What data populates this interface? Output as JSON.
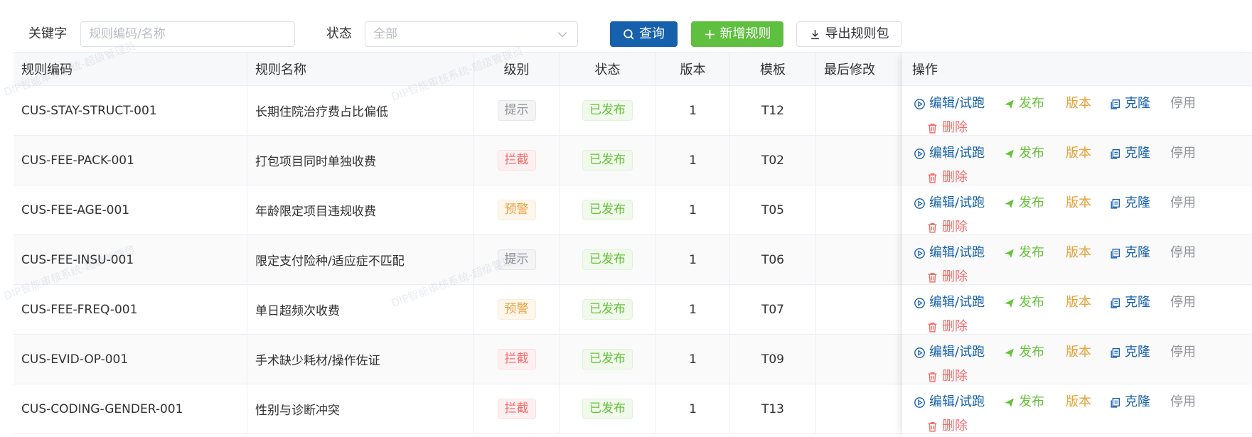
{
  "filters": {
    "keyword_label": "关键字",
    "keyword_placeholder": "规则编码/名称",
    "status_label": "状态",
    "status_value": "全部"
  },
  "actions": {
    "search_label": "查询",
    "add_label": "新增规则",
    "export_label": "导出规则包"
  },
  "table": {
    "columns": [
      "规则编码",
      "规则名称",
      "级别",
      "状态",
      "版本",
      "模板",
      "最后修改",
      "操作"
    ],
    "rows": [
      {
        "code": "CUS-STAY-STRUCT-001",
        "name": "长期住院治疗费占比偏低",
        "level": "提示",
        "level_type": "info",
        "status": "已发布",
        "version": "1",
        "template": "T12",
        "modified": ""
      },
      {
        "code": "CUS-FEE-PACK-001",
        "name": "打包项目同时单独收费",
        "level": "拦截",
        "level_type": "danger",
        "status": "已发布",
        "version": "1",
        "template": "T02",
        "modified": ""
      },
      {
        "code": "CUS-FEE-AGE-001",
        "name": "年龄限定项目违规收费",
        "level": "预警",
        "level_type": "warning",
        "status": "已发布",
        "version": "1",
        "template": "T05",
        "modified": ""
      },
      {
        "code": "CUS-FEE-INSU-001",
        "name": "限定支付险种/适应症不匹配",
        "level": "提示",
        "level_type": "info",
        "status": "已发布",
        "version": "1",
        "template": "T06",
        "modified": ""
      },
      {
        "code": "CUS-FEE-FREQ-001",
        "name": "单日超频次收费",
        "level": "预警",
        "level_type": "warning",
        "status": "已发布",
        "version": "1",
        "template": "T07",
        "modified": ""
      },
      {
        "code": "CUS-EVID-OP-001",
        "name": "手术缺少耗材/操作佐证",
        "level": "拦截",
        "level_type": "danger",
        "status": "已发布",
        "version": "1",
        "template": "T09",
        "modified": ""
      },
      {
        "code": "CUS-CODING-GENDER-001",
        "name": "性别与诊断冲突",
        "level": "拦截",
        "level_type": "danger",
        "status": "已发布",
        "version": "1",
        "template": "T13",
        "modified": ""
      }
    ],
    "row_actions": {
      "edit": "编辑/试跑",
      "publish": "发布",
      "version": "版本",
      "clone": "克隆",
      "disable": "停用",
      "delete": "删除"
    }
  },
  "watermark_text": "DIP智能审核系统-超级管理员",
  "colors": {
    "primary": "#1761ac",
    "success": "#5fbf3f",
    "warning": "#e6a23c",
    "danger": "#f56c6c",
    "info": "#909399"
  }
}
